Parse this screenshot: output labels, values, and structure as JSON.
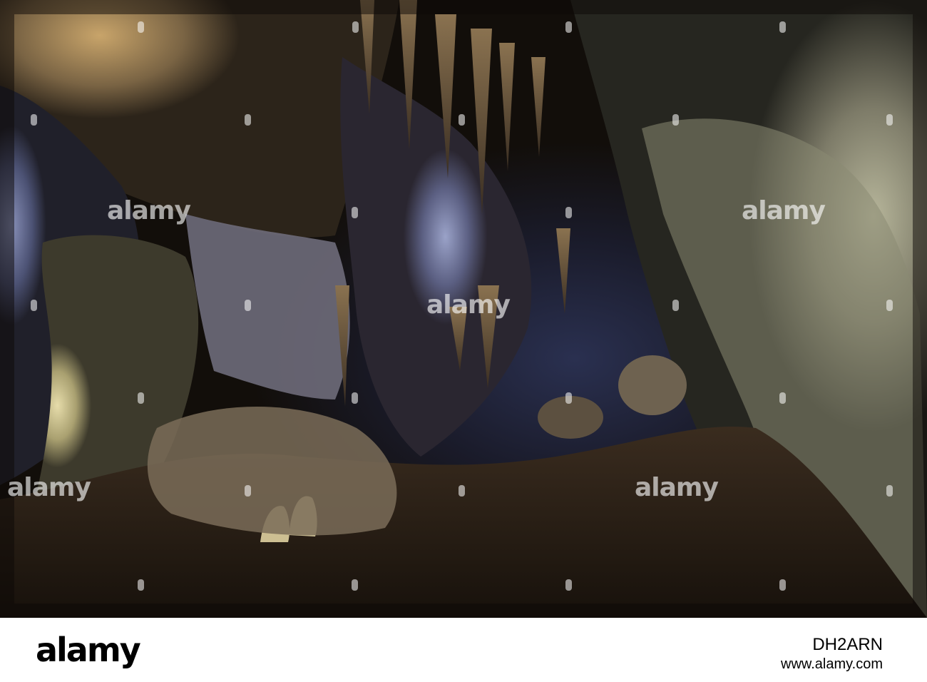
{
  "photo": {
    "subject": "limestone cave interior with stalactites and flowstone",
    "colors": {
      "shadow": "#140f0a",
      "rock_warm": "#a88a5a",
      "rock_cream": "#d8cfa0",
      "rock_blue": "#6f78a8",
      "floor": "#3a2c1f"
    }
  },
  "watermarks": [
    {
      "text": "alamy"
    },
    {
      "text": "alamy"
    },
    {
      "text": "alamy"
    },
    {
      "text": "alamy"
    },
    {
      "text": "alamy"
    },
    {
      "text": "alamy"
    },
    {
      "text": "alamy"
    }
  ],
  "footer": {
    "logo": "alamy",
    "image_code": "DH2ARN",
    "url": "www.alamy.com"
  }
}
